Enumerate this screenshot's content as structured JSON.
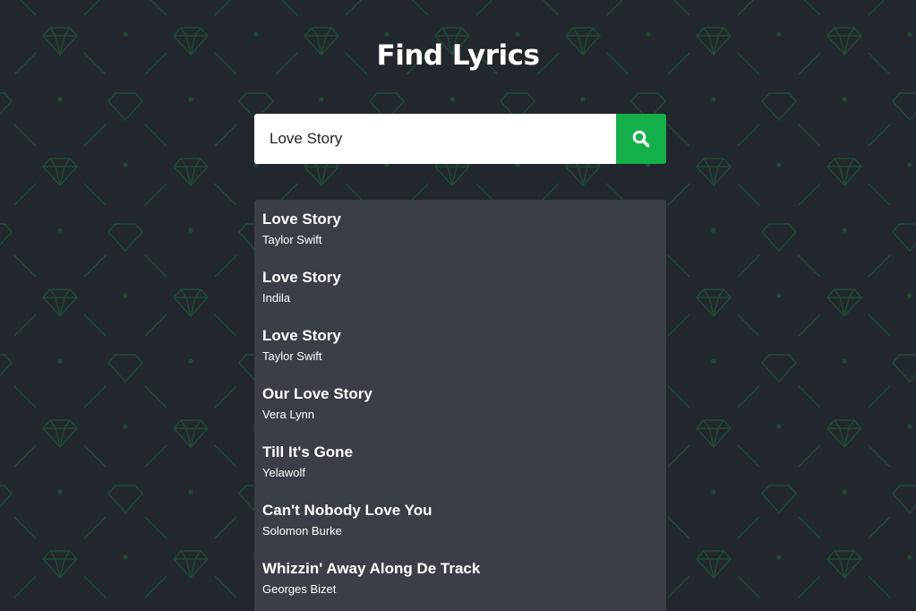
{
  "header": {
    "title": "Find Lyrics"
  },
  "search": {
    "value": "Love Story",
    "button_icon": "search-icon"
  },
  "results": [
    {
      "title": "Love Story",
      "artist": "Taylor Swift"
    },
    {
      "title": "Love Story",
      "artist": "Indila"
    },
    {
      "title": "Love Story",
      "artist": "Taylor Swift"
    },
    {
      "title": "Our Love Story",
      "artist": "Vera Lynn"
    },
    {
      "title": "Till It's Gone",
      "artist": "Yelawolf"
    },
    {
      "title": "Can't Nobody Love You",
      "artist": "Solomon Burke"
    },
    {
      "title": "Whizzin' Away Along De Track",
      "artist": "Georges Bizet"
    }
  ],
  "colors": {
    "background": "#22272e",
    "pattern": "#1f4a33",
    "accent": "#15b04a",
    "results_panel": "#3a3f47"
  }
}
